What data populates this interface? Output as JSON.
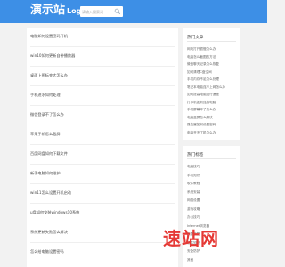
{
  "header": {
    "logo_text": "演示站",
    "logo_sub": "Logo",
    "search_placeholder": "请输入搜索词"
  },
  "main": {
    "items": [
      "电脑如何设置密码开机",
      "win10如何更新自带播放器",
      "桌面上图标变大怎么办",
      "手机进水如何处理",
      "微信登录不了怎么办",
      "苹果手机怎么截屏",
      "百度网盘如何下载文件",
      "新手电脑如何维护",
      "win11怎么设置开机启动",
      "u盘如何安装windows10系统",
      "系统更新失败怎么解决",
      "怎么给电脑设置密码"
    ]
  },
  "sidebar1": {
    "title": "热门文章",
    "links": [
      "网页打开很慢怎么办",
      "电脑怎么截图的方法",
      "微信聊天记录怎么恢复",
      "如何清理C盘空间",
      "手机内存不足怎么处理",
      "笔记本电脑连不上网怎么办",
      "如何提高电脑运行速度",
      "打印机如何连接电脑",
      "手机屏幕碎了怎么办",
      "电脑蓝屏怎么解决",
      "路由器如何设置密码",
      "电脑开不了机怎么办"
    ]
  },
  "sidebar2": {
    "title": "热门标签",
    "links": [
      "电脑技巧",
      "手机知识",
      "软件教程",
      "系统安装",
      "网络设置",
      "游戏攻略",
      "办公技巧",
      "Internet浏览器",
      "数据恢复",
      "硬件知识",
      "安全防护",
      "其他"
    ]
  },
  "watermark": {
    "text": "速站网"
  }
}
